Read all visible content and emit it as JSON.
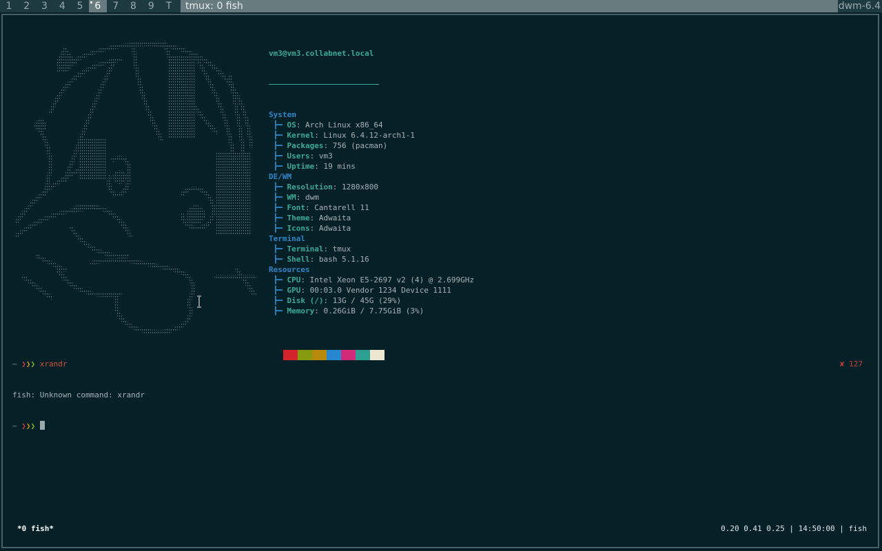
{
  "bar": {
    "tags": [
      "1",
      "2",
      "3",
      "4",
      "5",
      "6",
      "7",
      "8",
      "9",
      "T"
    ],
    "active_tag": "6",
    "window_title": "tmux: 0 fish",
    "status": "dwm-6.4"
  },
  "fetch": {
    "header": "vm3@vm3.collabnet.local",
    "sections": [
      {
        "title": "System",
        "rows": [
          {
            "key": "OS",
            "value": "Arch Linux x86_64"
          },
          {
            "key": "Kernel",
            "value": "Linux 6.4.12-arch1-1"
          },
          {
            "key": "Packages",
            "value": "756 (pacman)"
          },
          {
            "key": "Users",
            "value": "vm3"
          },
          {
            "key": "Uptime",
            "value": "19 mins"
          }
        ]
      },
      {
        "title": "DE/WM",
        "rows": [
          {
            "key": "Resolution",
            "value": "1280x800"
          },
          {
            "key": "WM",
            "value": "dwm"
          },
          {
            "key": "Font",
            "value": "Cantarell 11"
          },
          {
            "key": "Theme",
            "value": "Adwaita"
          },
          {
            "key": "Icons",
            "value": "Adwaita"
          }
        ]
      },
      {
        "title": "Terminal",
        "rows": [
          {
            "key": "Terminal",
            "value": "tmux"
          },
          {
            "key": "Shell",
            "value": "bash 5.1.16"
          }
        ]
      },
      {
        "title": "Resources",
        "rows": [
          {
            "key": "CPU",
            "value": "Intel Xeon E5-2697 v2 (4) @ 2.699GHz"
          },
          {
            "key": "GPU",
            "value": "00:03.0 Vendor 1234 Device 1111"
          },
          {
            "key": "Disk (/)",
            "value": "13G / 45G (29%)"
          },
          {
            "key": "Memory",
            "value": "0.26GiB / 7.75GiB (3%)"
          }
        ]
      }
    ],
    "palette": [
      "#052027",
      "#d3232d",
      "#859a0e",
      "#b88a0c",
      "#2887d1",
      "#d12a7b",
      "#2c9f92",
      "#ede7d2"
    ]
  },
  "shell": {
    "tilde": "~",
    "arrows": "❯❯❯",
    "cmd1": "xrandr",
    "error_line": "fish: Unknown command: xrandr",
    "exit_code": "✘ 127"
  },
  "tmux": {
    "window": "*0 fish*",
    "status_right": "0.20 0.41 0.25 | 14:50:00 | fish"
  },
  "colors": {
    "background": "#052027",
    "bar": "#1d3a41",
    "bar_selected": "#687b7f",
    "accent_teal": "#3aa999",
    "accent_blue": "#2d86c8",
    "error_red": "#c93c3c"
  }
}
